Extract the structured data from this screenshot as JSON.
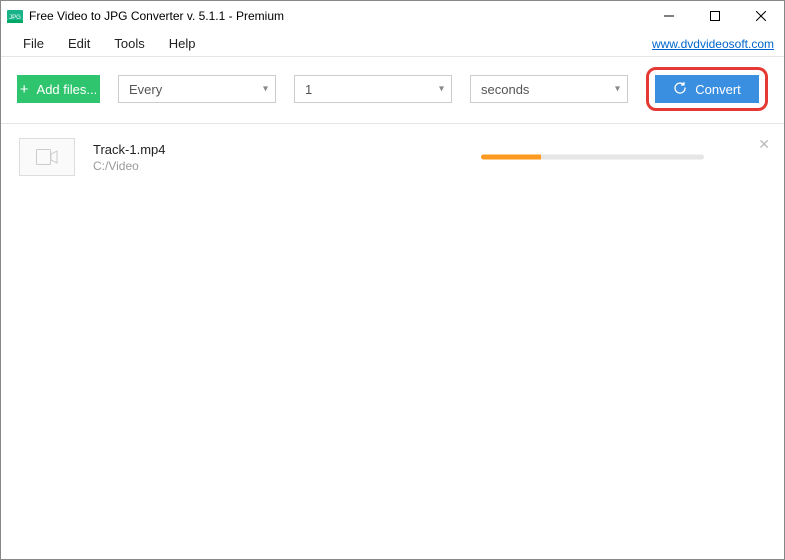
{
  "window": {
    "title": "Free Video to JPG Converter v. 5.1.1 - Premium"
  },
  "menu": {
    "file": "File",
    "edit": "Edit",
    "tools": "Tools",
    "help": "Help"
  },
  "site_link": "www.dvdvideosoft.com",
  "toolbar": {
    "add_label": "Add files...",
    "interval_mode": "Every",
    "interval_value": "1",
    "interval_unit": "seconds",
    "convert_label": "Convert"
  },
  "files": [
    {
      "name": "Track-1.mp4",
      "path": "C:/Video",
      "progress_pct": 27
    }
  ]
}
